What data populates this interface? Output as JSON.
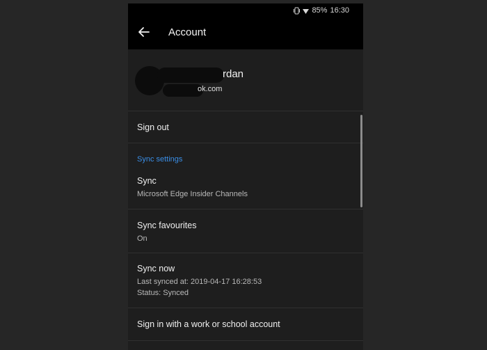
{
  "status_bar": {
    "battery": "85%",
    "time": "16:30"
  },
  "app_bar": {
    "title": "Account"
  },
  "profile": {
    "name_visible": "rdan",
    "email_visible": "ok.com"
  },
  "rows": {
    "sign_out": "Sign out",
    "sync_section_header": "Sync settings",
    "sync": {
      "title": "Sync",
      "subtitle": "Microsoft Edge Insider Channels"
    },
    "sync_favourites": {
      "title": "Sync favourites",
      "subtitle": "On"
    },
    "sync_now": {
      "title": "Sync now",
      "last_synced": "Last synced at: 2019-04-17 16:28:53",
      "status": "Status: Synced"
    },
    "work_account": "Sign in with a work or school account"
  },
  "icons": {
    "back": "back-arrow-icon",
    "vibrate": "vibrate-icon",
    "wifi": "wifi-icon"
  },
  "colors": {
    "background": "#1e1e1e",
    "app_bar": "#000000",
    "accent": "#3a8ee6"
  }
}
